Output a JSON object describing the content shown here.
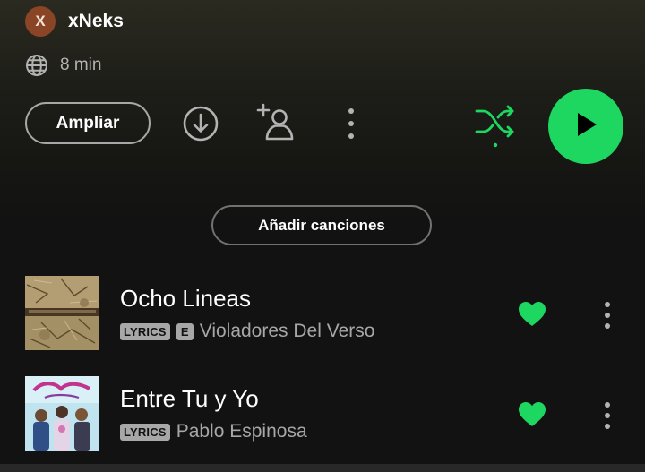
{
  "owner": {
    "avatar_letter": "X",
    "name": "xNeks"
  },
  "meta": {
    "globe_icon": "globe-icon",
    "duration": "8 min"
  },
  "actions": {
    "ampliar_label": "Ampliar",
    "download_icon": "download-icon",
    "add_user_icon": "add-user-icon",
    "more_icon": "more-vertical-icon",
    "shuffle_icon": "shuffle-icon",
    "play_icon": "play-icon"
  },
  "add_songs_label": "Añadir canciones",
  "tracks": [
    {
      "title": "Ocho Lineas",
      "lyrics_badge": "LYRICS",
      "explicit_badge": "E",
      "artist": "Violadores Del Verso",
      "liked": true
    },
    {
      "title": "Entre Tu y Yo",
      "lyrics_badge": "LYRICS",
      "artist": "Pablo Espinosa",
      "liked": true
    }
  ],
  "colors": {
    "accent_green": "#1ed760",
    "background": "#121212",
    "secondary_text": "#a7a7a7",
    "avatar_bg": "#8a4526"
  }
}
